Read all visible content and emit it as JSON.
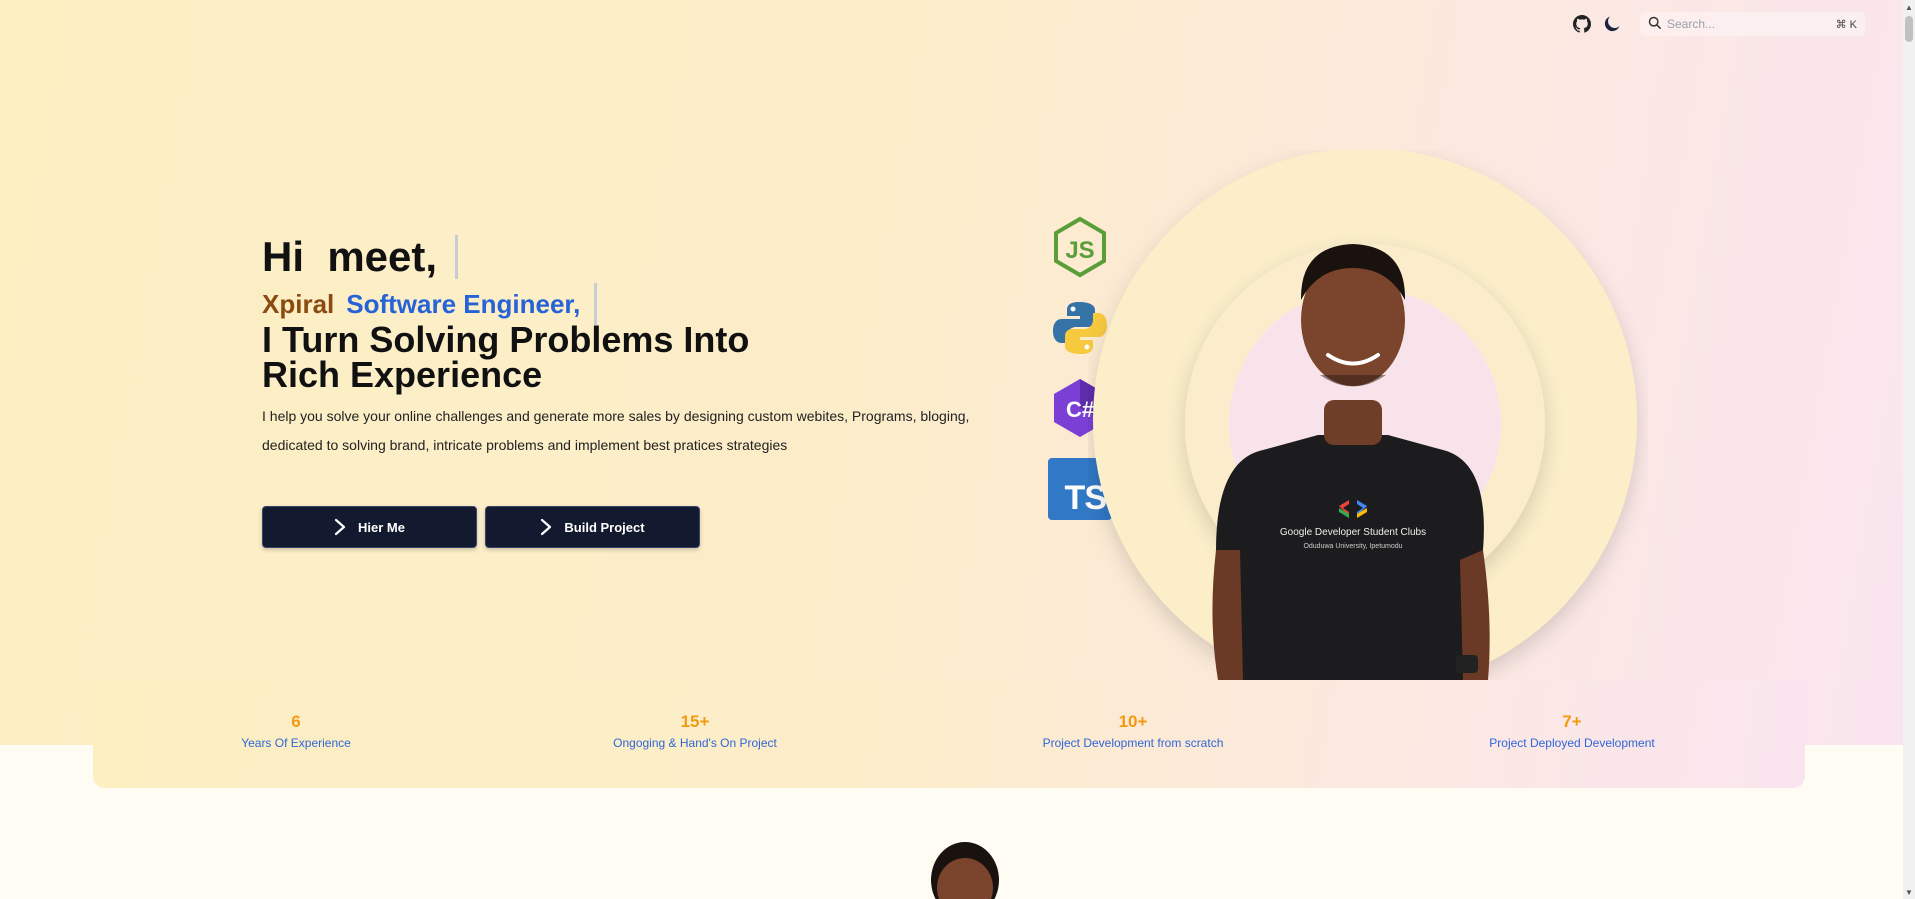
{
  "nav": {
    "github_icon": "github-icon",
    "theme_icon": "moon-icon",
    "search_placeholder": "Search...",
    "search_shortcut": "⌘ K"
  },
  "hero": {
    "greeting": "Hi  meet,",
    "name": "Xpiral",
    "role": "Software Engineer,",
    "headline_line1": "I Turn Solving Problems Into",
    "headline_line2": "Rich Experience",
    "description": "I help you solve your online challenges and generate more sales by designing custom webites, Programs, bloging, dedicated to solving brand, intricate problems and implement best pratices strategies",
    "buttons": [
      {
        "label": "Hier Me"
      },
      {
        "label": "Build Project"
      }
    ],
    "tech_icons": [
      "nodejs-icon",
      "python-icon",
      "csharp-icon",
      "typescript-icon"
    ],
    "ts_text": "TS",
    "csharp_text": "C#",
    "js_text": "JS",
    "shirt_text_line1": "Google Developer Student Clubs",
    "shirt_text_line2": "Oduduwa University, Ipetumodu"
  },
  "stats": [
    {
      "value": "6",
      "label": "Years Of Experience"
    },
    {
      "value": "15+",
      "label": "Ongoging & Hand's On Project"
    },
    {
      "value": "10+",
      "label": "Project Development from scratch"
    },
    {
      "value": "7+",
      "label": "Project Deployed Development"
    }
  ],
  "colors": {
    "accent_orange": "#f29a12",
    "accent_blue": "#2f66d8",
    "button_bg": "#131a30",
    "name_brown": "#8a4a10"
  }
}
